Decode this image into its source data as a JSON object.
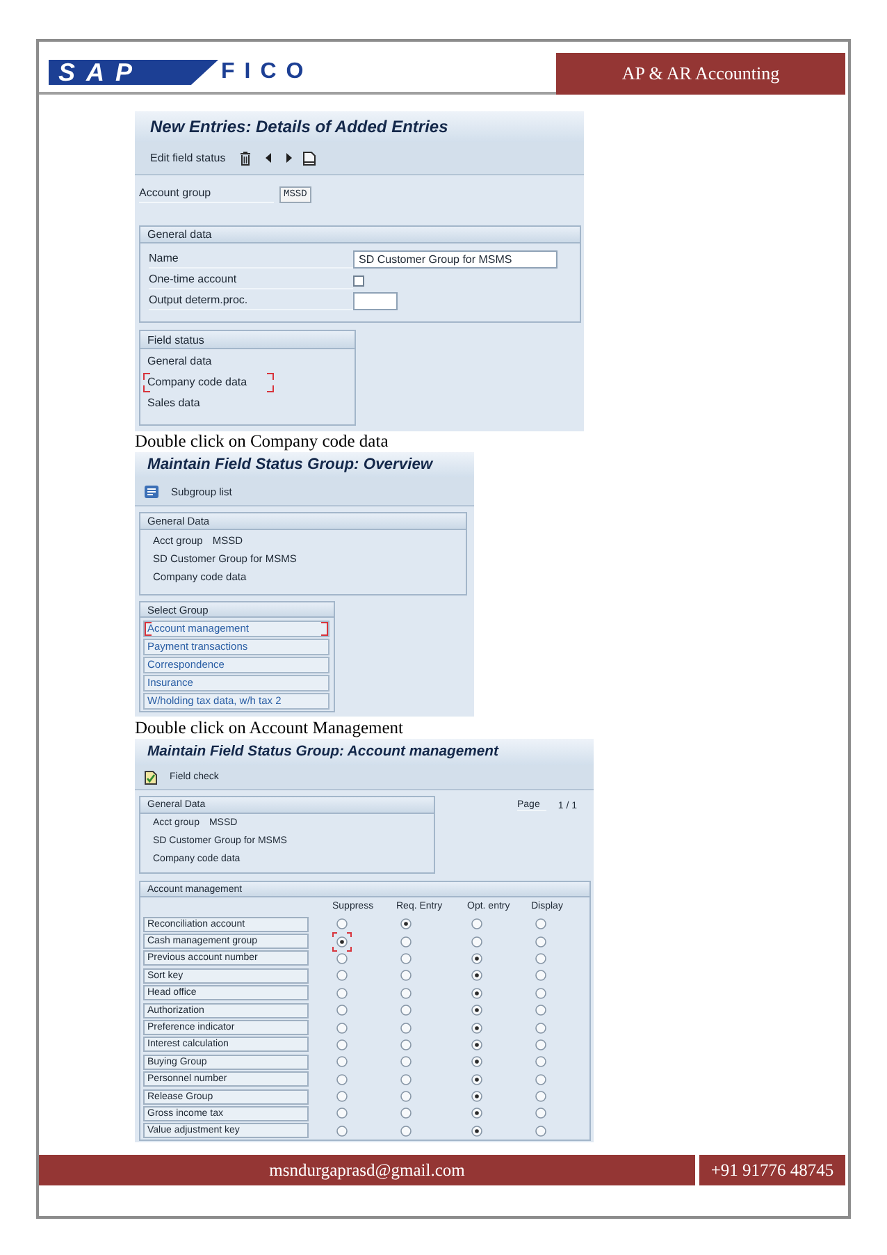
{
  "header": {
    "logo": {
      "mark": "SAP",
      "wordmark": "FICO"
    },
    "title": "AP & AR Accounting"
  },
  "screen_1": {
    "title": "New Entries: Details of Added Entries",
    "toolbar_button": "Edit field status",
    "account_group": {
      "label": "Account group",
      "value": "MSSD"
    },
    "general_data": {
      "title": "General data",
      "name": {
        "label": "Name",
        "value": "SD Customer Group for MSMS"
      },
      "one_time_account": {
        "label": "One-time account",
        "checked": false
      },
      "output_determ_proc": {
        "label": "Output determ.proc."
      }
    },
    "field_status": {
      "title": "Field status",
      "items": [
        {
          "label": "General data",
          "highlighted": false
        },
        {
          "label": "Company code data",
          "highlighted": true
        },
        {
          "label": "Sales data",
          "highlighted": false
        }
      ]
    }
  },
  "caption_1": "Double click on Company code data",
  "screen_2": {
    "title": "Maintain Field Status Group: Overview",
    "toolbar_button": "Subgroup list",
    "general_data": {
      "title": "General Data",
      "account_group": {
        "label": "Acct group",
        "value": "MSSD"
      },
      "name": "SD Customer Group for MSMS",
      "subgroup": "Company code data"
    },
    "select_group": {
      "title": "Select Group",
      "items": [
        {
          "label": "Account management",
          "highlighted": true
        },
        {
          "label": "Payment transactions",
          "highlighted": false
        },
        {
          "label": "Correspondence",
          "highlighted": false
        },
        {
          "label": "Insurance",
          "highlighted": false
        },
        {
          "label": "W/holding tax data, w/h tax 2",
          "highlighted": false
        }
      ]
    }
  },
  "caption_2": "Double click on Account Management",
  "screen_3": {
    "title": "Maintain Field Status Group: Account management",
    "toolbar_button": "Field check",
    "general_data": {
      "title": "General Data",
      "account_group": {
        "label": "Acct group",
        "value": "MSSD"
      },
      "name": "SD Customer Group for MSMS",
      "subgroup": "Company code data"
    },
    "page": {
      "label": "Page",
      "value": "1 / 1"
    },
    "account_management": {
      "title": "Account management",
      "columns": [
        "Suppress",
        "Req. Entry",
        "Opt. entry",
        "Display"
      ],
      "rows": [
        {
          "label": "Reconciliation account",
          "options": [
            {
              "selected": false,
              "highlighted": false
            },
            {
              "selected": true,
              "highlighted": false
            },
            {
              "selected": false,
              "highlighted": false
            },
            {
              "selected": false,
              "highlighted": false
            }
          ]
        },
        {
          "label": "Cash management group",
          "options": [
            {
              "selected": true,
              "highlighted": true
            },
            {
              "selected": false,
              "highlighted": false
            },
            {
              "selected": false,
              "highlighted": false
            },
            {
              "selected": false,
              "highlighted": false
            }
          ]
        },
        {
          "label": "Previous account number",
          "options": [
            {
              "selected": false,
              "highlighted": false
            },
            {
              "selected": false,
              "highlighted": false
            },
            {
              "selected": true,
              "highlighted": false
            },
            {
              "selected": false,
              "highlighted": false
            }
          ]
        },
        {
          "label": "Sort key",
          "options": [
            {
              "selected": false,
              "highlighted": false
            },
            {
              "selected": false,
              "highlighted": false
            },
            {
              "selected": true,
              "highlighted": false
            },
            {
              "selected": false,
              "highlighted": false
            }
          ]
        },
        {
          "label": "Head office",
          "options": [
            {
              "selected": false,
              "highlighted": false
            },
            {
              "selected": false,
              "highlighted": false
            },
            {
              "selected": true,
              "highlighted": false
            },
            {
              "selected": false,
              "highlighted": false
            }
          ]
        },
        {
          "label": "Authorization",
          "options": [
            {
              "selected": false,
              "highlighted": false
            },
            {
              "selected": false,
              "highlighted": false
            },
            {
              "selected": true,
              "highlighted": false
            },
            {
              "selected": false,
              "highlighted": false
            }
          ]
        },
        {
          "label": "Preference indicator",
          "options": [
            {
              "selected": false,
              "highlighted": false
            },
            {
              "selected": false,
              "highlighted": false
            },
            {
              "selected": true,
              "highlighted": false
            },
            {
              "selected": false,
              "highlighted": false
            }
          ]
        },
        {
          "label": "Interest calculation",
          "options": [
            {
              "selected": false,
              "highlighted": false
            },
            {
              "selected": false,
              "highlighted": false
            },
            {
              "selected": true,
              "highlighted": false
            },
            {
              "selected": false,
              "highlighted": false
            }
          ]
        },
        {
          "label": "Buying Group",
          "options": [
            {
              "selected": false,
              "highlighted": false
            },
            {
              "selected": false,
              "highlighted": false
            },
            {
              "selected": true,
              "highlighted": false
            },
            {
              "selected": false,
              "highlighted": false
            }
          ]
        },
        {
          "label": "Personnel number",
          "options": [
            {
              "selected": false,
              "highlighted": false
            },
            {
              "selected": false,
              "highlighted": false
            },
            {
              "selected": true,
              "highlighted": false
            },
            {
              "selected": false,
              "highlighted": false
            }
          ]
        },
        {
          "label": "Release Group",
          "options": [
            {
              "selected": false,
              "highlighted": false
            },
            {
              "selected": false,
              "highlighted": false
            },
            {
              "selected": true,
              "highlighted": false
            },
            {
              "selected": false,
              "highlighted": false
            }
          ]
        },
        {
          "label": "Gross income tax",
          "options": [
            {
              "selected": false,
              "highlighted": false
            },
            {
              "selected": false,
              "highlighted": false
            },
            {
              "selected": true,
              "highlighted": false
            },
            {
              "selected": false,
              "highlighted": false
            }
          ]
        },
        {
          "label": "Value adjustment key",
          "options": [
            {
              "selected": false,
              "highlighted": false
            },
            {
              "selected": false,
              "highlighted": false
            },
            {
              "selected": true,
              "highlighted": false
            },
            {
              "selected": false,
              "highlighted": false
            }
          ]
        }
      ]
    }
  },
  "footer": {
    "email": "msndurgaprasd@gmail.com",
    "phone": "+91 91776 48745"
  }
}
